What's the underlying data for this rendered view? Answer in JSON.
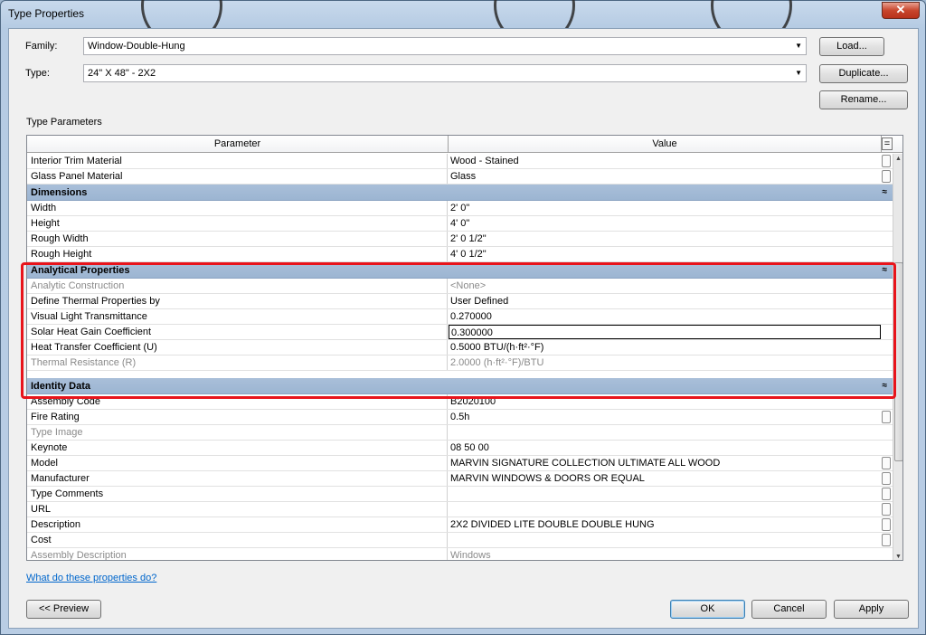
{
  "window": {
    "title": "Type Properties",
    "close": "✕"
  },
  "family": {
    "label": "Family:",
    "value": "Window-Double-Hung"
  },
  "type": {
    "label": "Type:",
    "value": "24\" X 48\" - 2X2"
  },
  "buttons": {
    "load": "Load...",
    "duplicate": "Duplicate...",
    "rename": "Rename...",
    "preview": "<< Preview",
    "ok": "OK",
    "cancel": "Cancel",
    "apply": "Apply"
  },
  "section_label": "Type Parameters",
  "grid": {
    "col_parameter": "Parameter",
    "col_value": "Value",
    "col_menu": "="
  },
  "rows_top": [
    {
      "name": "Interior Trim Material",
      "value": "Wood - Stained",
      "btn": true
    },
    {
      "name": "Glass Panel Material",
      "value": "Glass",
      "btn": true
    }
  ],
  "groups": {
    "dimensions": "Dimensions",
    "analytical": "Analytical Properties",
    "identity": "Identity Data"
  },
  "rows_dimensions": [
    {
      "name": "Width",
      "value": "2'  0\""
    },
    {
      "name": "Height",
      "value": "4'  0\""
    },
    {
      "name": "Rough Width",
      "value": "2'  0 1/2\""
    },
    {
      "name": "Rough Height",
      "value": "4'  0 1/2\""
    }
  ],
  "rows_analytical": [
    {
      "name": "Analytic Construction",
      "value": "<None>",
      "grey": true
    },
    {
      "name": "Define Thermal Properties by",
      "value": "User Defined"
    },
    {
      "name": "Visual Light Transmittance",
      "value": "0.270000"
    },
    {
      "name": "Solar Heat Gain Coefficient",
      "value": "0.300000",
      "selected": true
    },
    {
      "name": "Heat Transfer Coefficient (U)",
      "value": "0.5000 BTU/(h·ft²·°F)"
    },
    {
      "name": "Thermal Resistance (R)",
      "value": "2.0000 (h·ft²·°F)/BTU",
      "grey": true
    }
  ],
  "rows_identity": [
    {
      "name": "Assembly Code",
      "value": "B2020100"
    },
    {
      "name": "Fire Rating",
      "value": "0.5h",
      "btn": true
    },
    {
      "name": "Type Image",
      "value": "",
      "grey": true
    },
    {
      "name": "Keynote",
      "value": "08 50 00"
    },
    {
      "name": "Model",
      "value": "MARVIN SIGNATURE COLLECTION ULTIMATE ALL WOOD",
      "btn": true
    },
    {
      "name": "Manufacturer",
      "value": "MARVIN WINDOWS & DOORS OR EQUAL",
      "btn": true
    },
    {
      "name": "Type Comments",
      "value": "",
      "btn": true
    },
    {
      "name": "URL",
      "value": "",
      "btn": true
    },
    {
      "name": "Description",
      "value": "2X2 DIVIDED LITE DOUBLE DOUBLE HUNG",
      "btn": true
    },
    {
      "name": "Cost",
      "value": "",
      "btn": true
    },
    {
      "name": "Assembly Description",
      "value": "Windows",
      "grey": true
    }
  ],
  "help_link": "What do these properties do?",
  "colors": {
    "highlight": "#e8141b",
    "group_band": "#a9bfd9",
    "link": "#0066cc"
  }
}
